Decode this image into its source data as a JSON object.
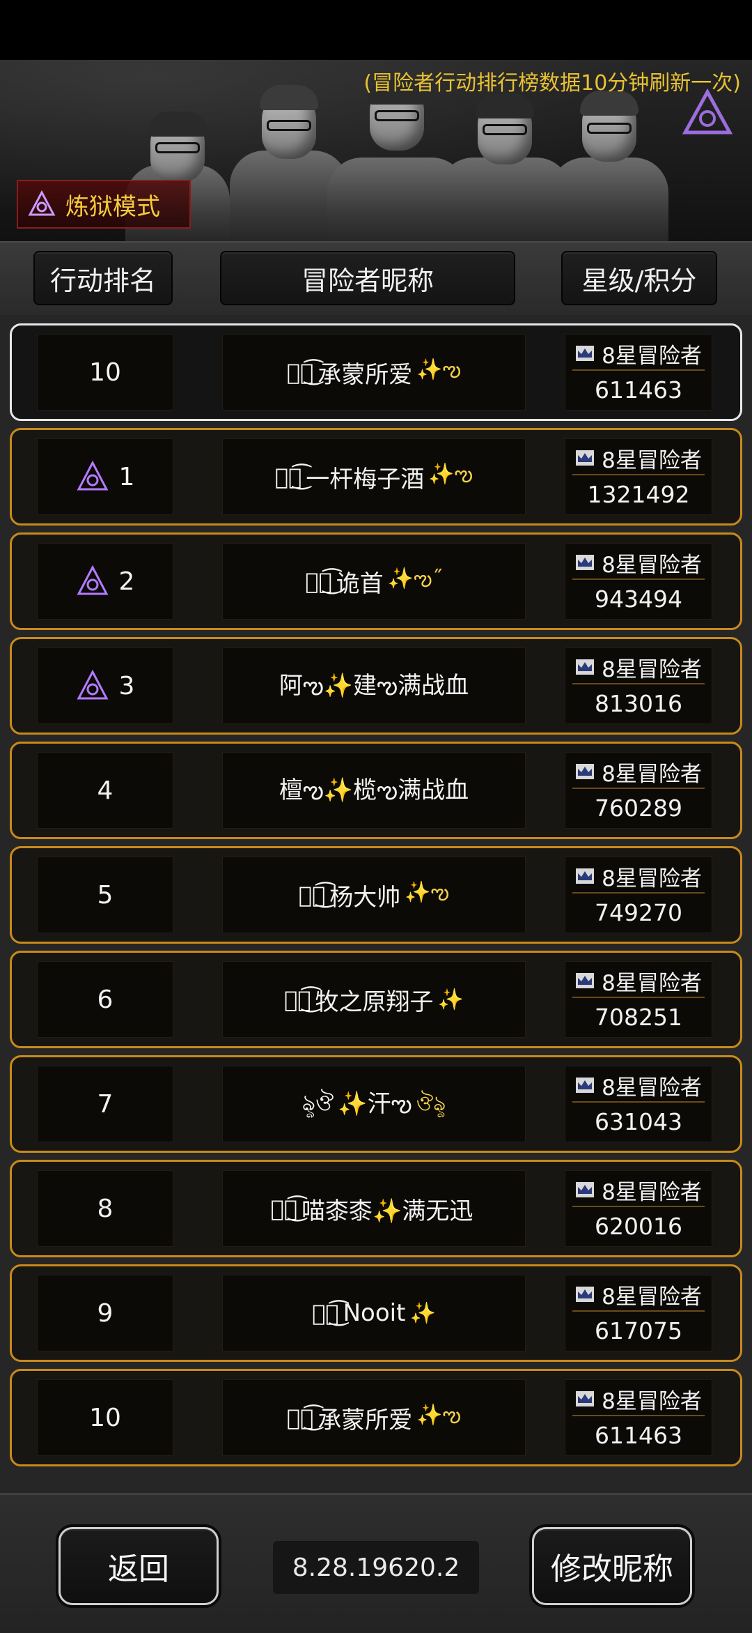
{
  "banner": {
    "notice": "(冒险者行动排行榜数据10分钟刷新一次)",
    "mode_label": "炼狱模式"
  },
  "header": {
    "rank_label": "行动排名",
    "nickname_label": "冒险者昵称",
    "score_label": "星级/积分"
  },
  "my_row": {
    "rank": "10",
    "name_deco_left": "ঔৣ͜͡",
    "name": "承蒙所爱",
    "name_deco_right": "✨ఌ",
    "star": "8星冒险者",
    "score": "611463"
  },
  "rows": [
    {
      "rank": "1",
      "hell_icon": true,
      "deco_left": "ঔৣ͜͡",
      "name": "一杆梅子酒",
      "deco_right": "✨ఌ",
      "star": "8星冒险者",
      "score": "1321492"
    },
    {
      "rank": "2",
      "hell_icon": true,
      "deco_left": "ঔৣ͜͡",
      "name": "诡首",
      "deco_right": "✨ఌ˝",
      "star": "8星冒险者",
      "score": "943494"
    },
    {
      "rank": "3",
      "hell_icon": true,
      "deco_left": "",
      "name": "阿ఌ✨建ఌ满战血",
      "deco_right": "",
      "star": "8星冒险者",
      "score": "813016"
    },
    {
      "rank": "4",
      "hell_icon": false,
      "deco_left": "",
      "name": "檀ఌ✨榄ఌ满战血",
      "deco_right": "",
      "star": "8星冒险者",
      "score": "760289"
    },
    {
      "rank": "5",
      "hell_icon": false,
      "deco_left": "ঔৣ͜͡",
      "name": "杨大帅",
      "deco_right": "✨ఌ",
      "star": "8星冒险者",
      "score": "749270"
    },
    {
      "rank": "6",
      "hell_icon": false,
      "deco_left": "ঔৣ͜͡",
      "name": "牧之原翔子",
      "deco_right": "✨",
      "star": "8星冒险者",
      "score": "708251"
    },
    {
      "rank": "7",
      "hell_icon": false,
      "deco_left": "ৡঔ",
      "name": "✨汗ఌ",
      "deco_right": "ঔৡ",
      "star": "8星冒险者",
      "score": "631043"
    },
    {
      "rank": "8",
      "hell_icon": false,
      "deco_left": "ঔৣ͜͡",
      "name": "喵桼桼✨满无迅",
      "deco_right": "",
      "star": "8星冒险者",
      "score": "620016"
    },
    {
      "rank": "9",
      "hell_icon": false,
      "deco_left": "ঔৣ͜͡",
      "name": "Nooit",
      "deco_right": "✨",
      "star": "8星冒险者",
      "score": "617075"
    },
    {
      "rank": "10",
      "hell_icon": false,
      "deco_left": "ঔৣ͜͡",
      "name": "承蒙所爱",
      "deco_right": "✨ఌ",
      "star": "8星冒险者",
      "score": "611463"
    }
  ],
  "footer": {
    "back_label": "返回",
    "version": "8.28.19620.2",
    "rename_label": "修改昵称"
  },
  "colors": {
    "accent_gold": "#c98a1a",
    "notice_yellow": "#e9c233",
    "hell_purple": "#b37bff"
  },
  "icons": {
    "mode": "hell-sigil-icon",
    "crown": "crown-icon"
  }
}
